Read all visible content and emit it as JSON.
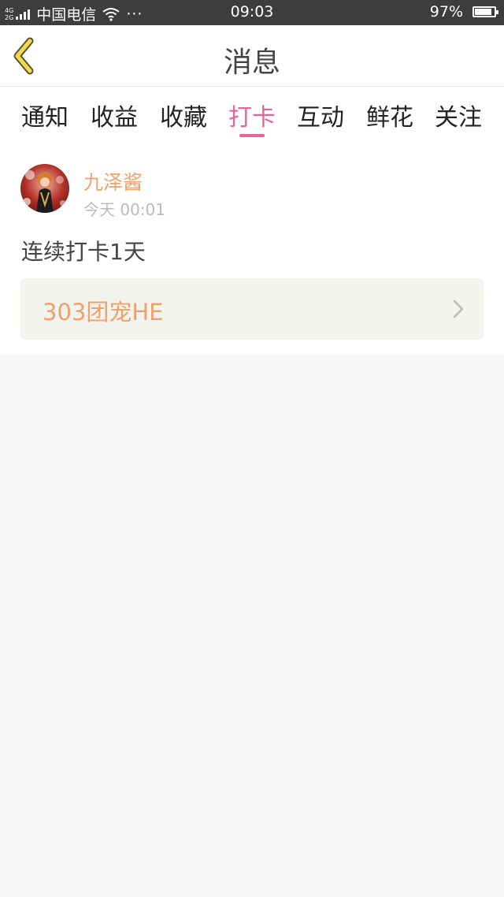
{
  "status_bar": {
    "network_top": "4G",
    "network_bottom": "2G",
    "carrier": "中国电信",
    "more": "···",
    "time": "09:03",
    "battery": "97%",
    "battery_level": 0.97
  },
  "header": {
    "title": "消息",
    "back_icon": "chevron-left-icon"
  },
  "tabs": [
    {
      "label": "通知",
      "active": false
    },
    {
      "label": "收益",
      "active": false
    },
    {
      "label": "收藏",
      "active": false
    },
    {
      "label": "打卡",
      "active": true
    },
    {
      "label": "互动",
      "active": false
    },
    {
      "label": "鲜花",
      "active": false
    },
    {
      "label": "关注",
      "active": false
    }
  ],
  "message": {
    "username": "九泽酱",
    "timestamp": "今天 00:01",
    "text": "连续打卡1天",
    "link_title": "303团宠HE"
  },
  "colors": {
    "accent_pink": "#e4649b",
    "accent_orange": "#f0a06a",
    "back_icon_yellow": "#f5d94e"
  }
}
